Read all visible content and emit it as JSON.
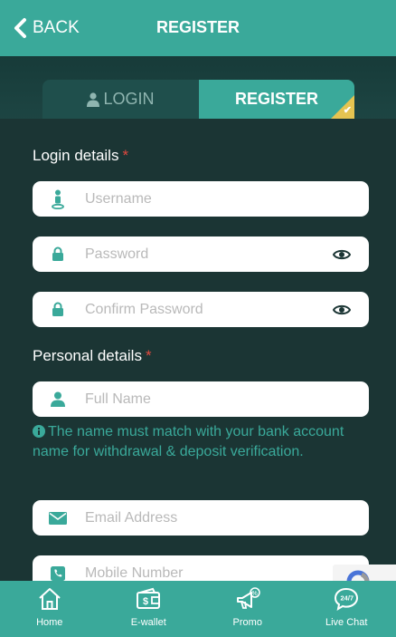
{
  "header": {
    "back_label": "BACK",
    "title": "REGISTER"
  },
  "tabs": [
    {
      "label": "LOGIN",
      "active": false
    },
    {
      "label": "REGISTER",
      "active": true
    }
  ],
  "login_details": {
    "label": "Login details",
    "required_mark": "*",
    "username_placeholder": "Username",
    "password_placeholder": "Password",
    "confirm_password_placeholder": "Confirm Password"
  },
  "personal_details": {
    "label": "Personal details",
    "required_mark": "*",
    "fullname_placeholder": "Full Name",
    "note": "The name must match with your bank account name for withdrawal & deposit verification.",
    "email_placeholder": "Email Address",
    "mobile_placeholder": "Mobile Number"
  },
  "bottom_nav": [
    {
      "label": "Home",
      "icon": "home-icon"
    },
    {
      "label": "E-wallet",
      "icon": "wallet-icon"
    },
    {
      "label": "Promo",
      "icon": "megaphone-icon"
    },
    {
      "label": "Live Chat",
      "icon": "chat-24-7-icon"
    }
  ],
  "colors": {
    "teal": "#3aa99a",
    "dark_bg": "#1b3534",
    "required": "#e0493f",
    "badge": "#e5c451"
  }
}
